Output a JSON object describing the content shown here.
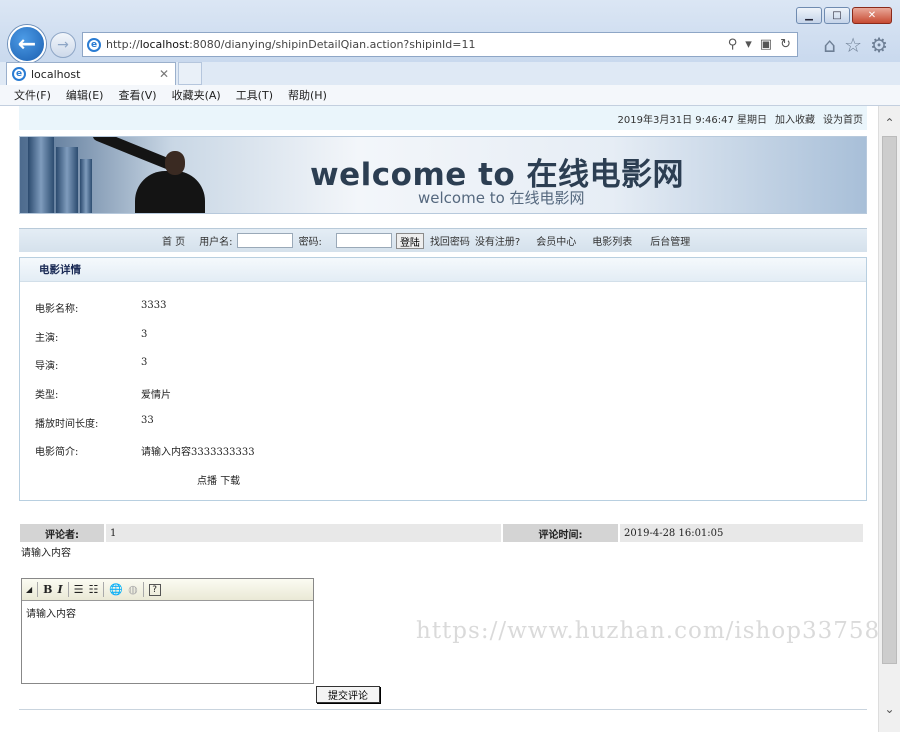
{
  "browser": {
    "url_prefix": "http://",
    "url_host": "localhost",
    "url_rest": ":8080/dianying/shipinDetailQian.action?shipinId=11",
    "tab_title": "localhost",
    "menu": [
      "文件(F)",
      "编辑(E)",
      "查看(V)",
      "收藏夹(A)",
      "工具(T)",
      "帮助(H)"
    ]
  },
  "topbar": {
    "datetime": "2019年3月31日  9:46:47  星期日",
    "add_favorite": "加入收藏",
    "set_home": "设为首页"
  },
  "banner": {
    "title": "welcome to 在线电影网",
    "subtitle": "welcome to 在线电影网"
  },
  "nav": {
    "home": "首  页",
    "username_label": "用户名:",
    "password_label": "密码:",
    "login": "登陆",
    "forgot": "找回密码",
    "register": "没有注册?",
    "member": "会员中心",
    "movie_list": "电影列表",
    "admin": "后台管理"
  },
  "detail": {
    "heading": "电影详情",
    "rows": [
      {
        "label": "电影名称:",
        "value": "3333"
      },
      {
        "label": "主演:",
        "value": "3"
      },
      {
        "label": "导演:",
        "value": "3"
      },
      {
        "label": "类型:",
        "value": "爱情片"
      },
      {
        "label": "播放时间长度:",
        "value": "33"
      },
      {
        "label": "电影简介:",
        "value": "请输入内容3333333333"
      }
    ],
    "play": "点播",
    "download": "下载"
  },
  "comments": {
    "author_label": "评论者:",
    "author_value": "1",
    "time_label": "评论时间:",
    "time_value": "2019-4-28 16:01:05",
    "content": "请输入内容"
  },
  "editor": {
    "content": "请输入内容",
    "submit": "提交评论"
  },
  "watermark": "https://www.huzhan.com/ishop33758"
}
